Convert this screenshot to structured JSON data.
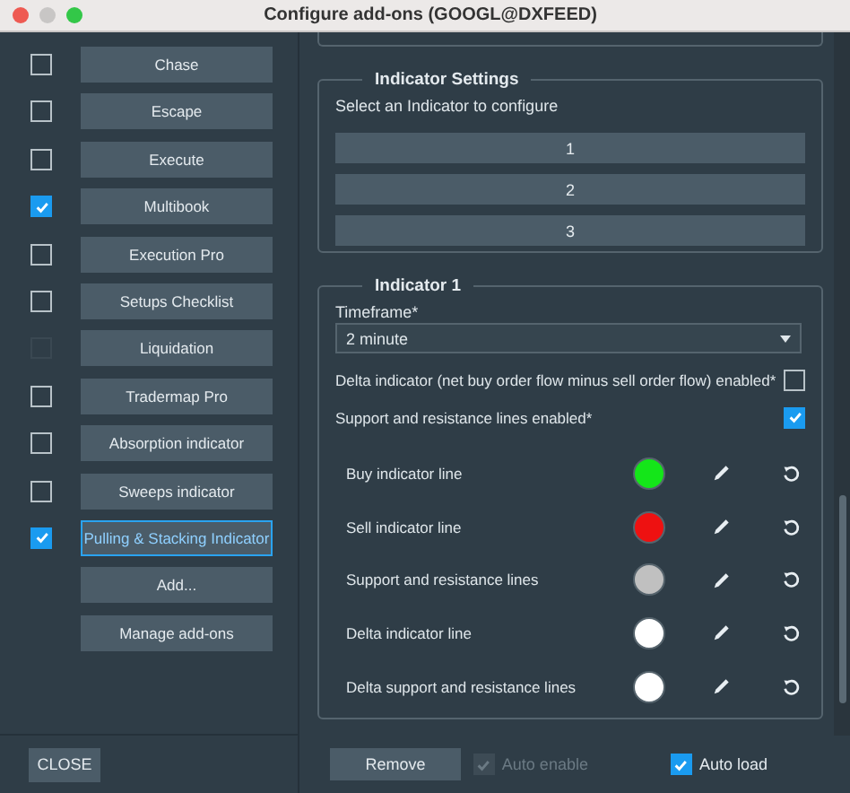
{
  "window": {
    "title": "Configure add-ons (GOOGL@DXFEED)"
  },
  "addons": [
    {
      "label": "Chase",
      "checked": false,
      "disabled": false,
      "selected": false
    },
    {
      "label": "Escape",
      "checked": false,
      "disabled": false,
      "selected": false
    },
    {
      "label": "Execute",
      "checked": false,
      "disabled": false,
      "selected": false
    },
    {
      "label": "Multibook",
      "checked": true,
      "disabled": false,
      "selected": false
    },
    {
      "label": "Execution Pro",
      "checked": false,
      "disabled": false,
      "selected": false
    },
    {
      "label": "Setups Checklist",
      "checked": false,
      "disabled": false,
      "selected": false
    },
    {
      "label": "Liquidation",
      "checked": false,
      "disabled": true,
      "selected": false
    },
    {
      "label": "Tradermap Pro",
      "checked": false,
      "disabled": false,
      "selected": false
    },
    {
      "label": "Absorption indicator",
      "checked": false,
      "disabled": false,
      "selected": false
    },
    {
      "label": "Sweeps indicator",
      "checked": false,
      "disabled": false,
      "selected": false
    },
    {
      "label": "Pulling & Stacking Indicator",
      "checked": true,
      "disabled": false,
      "selected": true
    }
  ],
  "addon_actions": [
    "Add...",
    "Manage add-ons"
  ],
  "close_button": "CLOSE",
  "indicator_settings": {
    "legend": "Indicator Settings",
    "prompt": "Select an Indicator to configure",
    "buttons": [
      "1",
      "2",
      "3"
    ]
  },
  "indicator": {
    "legend": "Indicator 1",
    "timeframe_label": "Timeframe*",
    "timeframe_value": "2 minute",
    "toggles": [
      {
        "label": "Delta indicator (net buy order flow minus sell order flow) enabled*",
        "checked": false
      },
      {
        "label": "Support and resistance lines enabled*",
        "checked": true
      }
    ],
    "colors": [
      {
        "label": "Buy indicator line",
        "color": "#14e619"
      },
      {
        "label": "Sell indicator line",
        "color": "#ee1111"
      },
      {
        "label": "Support and resistance lines",
        "color": "#c0c0c0"
      },
      {
        "label": "Delta indicator line",
        "color": "#ffffff"
      },
      {
        "label": "Delta support and resistance lines",
        "color": "#ffffff"
      }
    ]
  },
  "footer": {
    "remove_button": "Remove",
    "options": [
      {
        "label": "Auto enable",
        "checked": true,
        "disabled": true
      },
      {
        "label": "Auto load",
        "checked": true,
        "disabled": false
      }
    ]
  }
}
